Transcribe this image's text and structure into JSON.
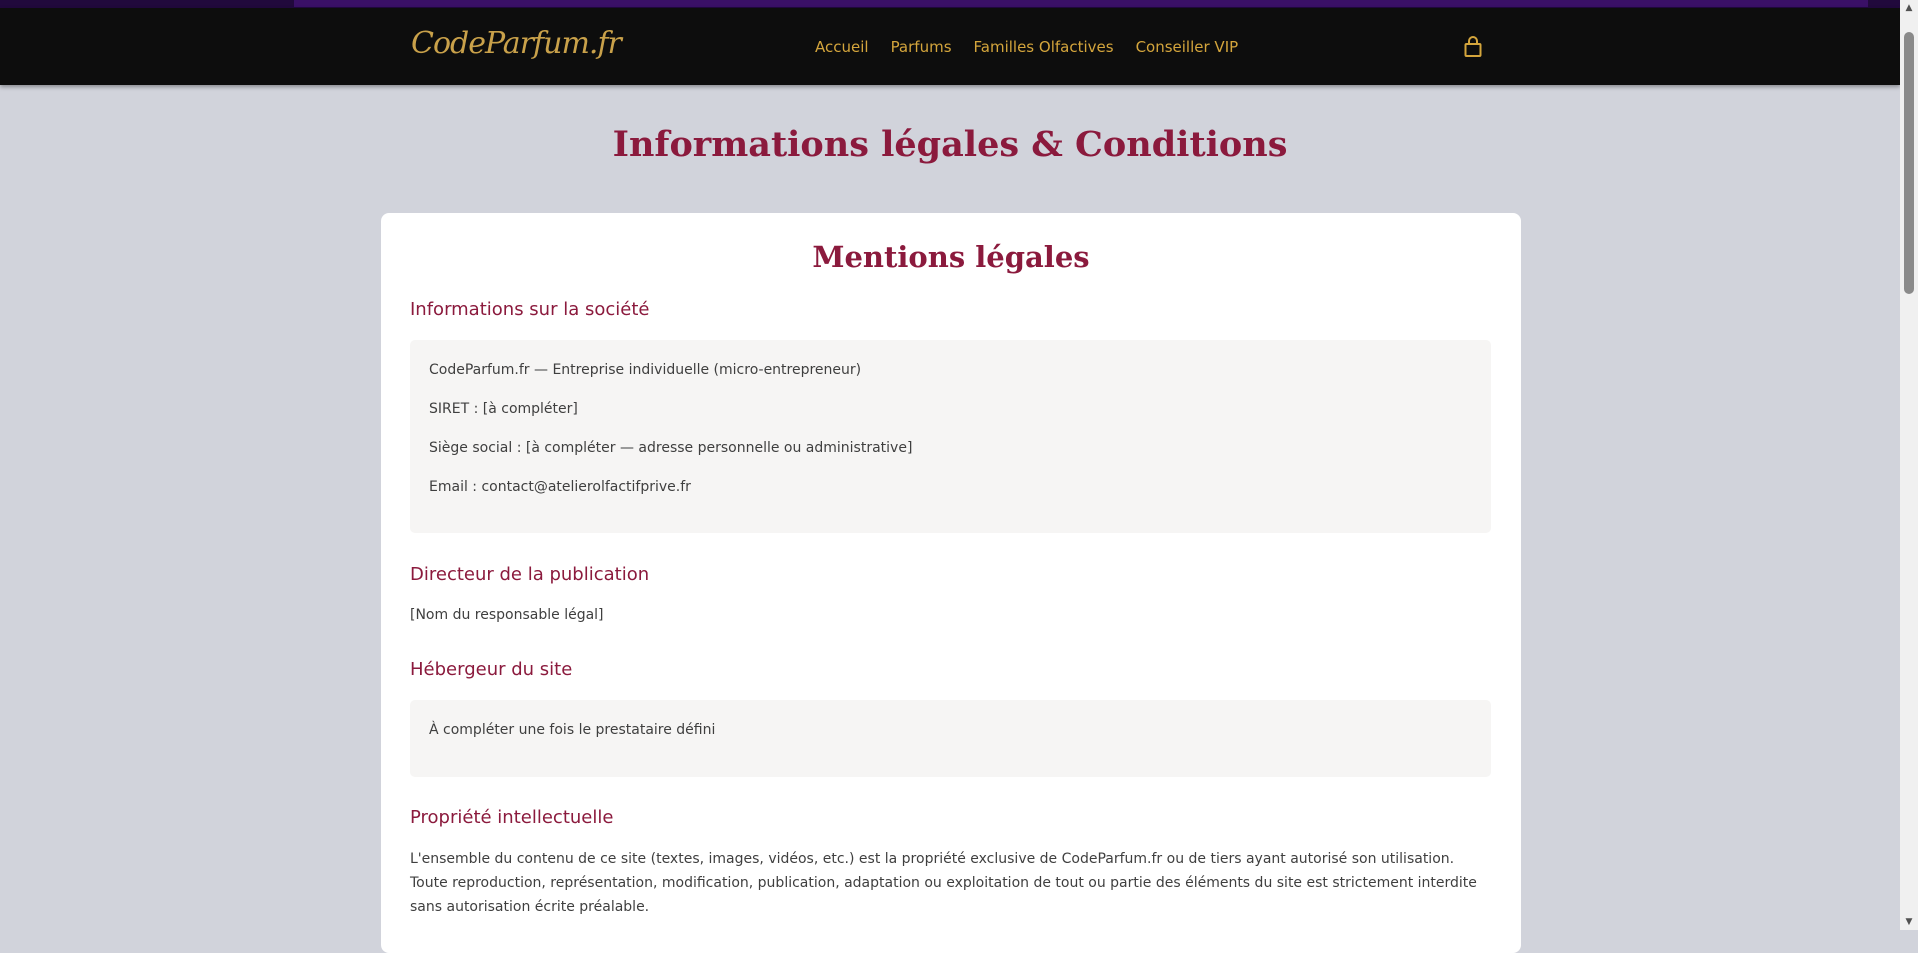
{
  "header": {
    "logo": "CodeParfum.fr",
    "nav": [
      "Accueil",
      "Parfums",
      "Familles Olfactives",
      "Conseiller VIP"
    ],
    "cart_icon": "shopping-bag-icon"
  },
  "page": {
    "title": "Informations légales & Conditions"
  },
  "card": {
    "title": "Mentions légales",
    "sections": {
      "societe": {
        "heading": "Informations sur la société",
        "lines": [
          "CodeParfum.fr — Entreprise individuelle (micro-entrepreneur)",
          "SIRET : [à compléter]",
          "Siège social : [à compléter — adresse personnelle ou administrative]",
          "Email : contact@atelierolfactifprive.fr"
        ]
      },
      "directeur": {
        "heading": "Directeur de la publication",
        "text": "[Nom du responsable légal]"
      },
      "hebergeur": {
        "heading": "Hébergeur du site",
        "text": "À compléter une fois le prestataire défini"
      },
      "propriete": {
        "heading": "Propriété intellectuelle",
        "text": "L'ensemble du contenu de ce site (textes, images, vidéos, etc.) est la propriété exclusive de CodeParfum.fr ou de tiers ayant autorisé son utilisation. Toute reproduction, représentation, modification, publication, adaptation ou exploitation de tout ou partie des éléments du site est strictement interdite sans autorisation écrite préalable."
      }
    }
  },
  "colors": {
    "accent": "#8b1a3d",
    "nav_gold": "#d4a53c",
    "header_bg": "#0d0d0d",
    "page_bg": "#d1d3db"
  }
}
